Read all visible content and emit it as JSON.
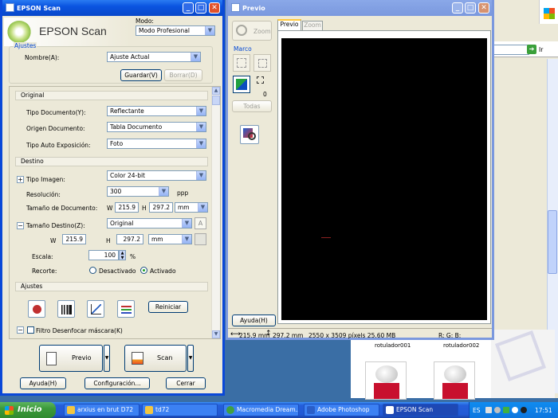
{
  "background_window": {
    "go_label": "Ir",
    "files": [
      {
        "name": "rotulador001"
      },
      {
        "name": "rotulador002"
      }
    ]
  },
  "epson": {
    "title": "EPSON Scan",
    "logo_text": "EPSON Scan",
    "mode_label": "Modo:",
    "mode_value": "Modo Profesional",
    "ajustes_group": "Ajustes",
    "nombre_label": "Nombre(A):",
    "nombre_value": "Ajuste Actual",
    "guardar_label": "Guardar(V)",
    "borrar_label": "Borrar(D)",
    "original_section": "Original",
    "tipo_doc_label": "Tipo Documento(Y):",
    "tipo_doc_value": "Reflectante",
    "origen_label": "Origen Documento:",
    "origen_value": "Tabla Documento",
    "tipo_auto_label": "Tipo Auto Exposición:",
    "tipo_auto_value": "Foto",
    "destino_section": "Destino",
    "tipo_imagen_label": "Tipo Imagen:",
    "tipo_imagen_value": "Color 24-bit",
    "resolucion_label": "Resolución:",
    "resolucion_value": "300",
    "resolucion_unit": "ppp",
    "tamano_doc_label": "Tamaño de Documento:",
    "w_label": "W",
    "h_label": "H",
    "doc_w": "215.9",
    "doc_h": "297.2",
    "unit_value": "mm",
    "tamano_dest_label": "Tamaño Destino(Z):",
    "tamano_dest_value": "Original",
    "dest_w": "215.9",
    "dest_h": "297.2",
    "dest_unit": "mm",
    "escala_label": "Escala:",
    "escala_value": "100",
    "escala_unit": "%",
    "recorte_label": "Recorte:",
    "desactivado_label": "Desactivado",
    "activado_label": "Activado",
    "ajustes_section": "Ajustes",
    "reiniciar_label": "Reiniciar",
    "filtro_label": "Filtro Desenfocar máscara(K)",
    "previo_label": "Previo",
    "scan_label": "Scan",
    "ayuda_label": "Ayuda(H)",
    "config_label": "Configuración...",
    "cerrar_label": "Cerrar"
  },
  "preview": {
    "title": "Previo",
    "zoom_label": "Zoom",
    "marco_label": "Marco",
    "marco_count": "0",
    "todas_label": "Todas",
    "tab_previo": "Previo",
    "tab_zoom": "Zoom",
    "ayuda_label": "Ayuda(H)",
    "status_w": "215.9 mm",
    "status_h": "297.2 mm",
    "status_pixels": "2550 x 3509 píxels 25.60 MB",
    "status_rgb": "R: G: B:"
  },
  "taskbar": {
    "start_label": "Inicio",
    "tasks": [
      {
        "label": "arxius en brut D72"
      },
      {
        "label": "td72"
      },
      {
        "label": "Macromedia Dream..."
      },
      {
        "label": "Adobe Photoshop"
      },
      {
        "label": "EPSON Scan"
      }
    ],
    "lang": "ES",
    "clock": "17:51"
  },
  "colors": {
    "titlebar": "#0a54e0",
    "preview_bg": "#000000",
    "desktop": "#3a6ea5"
  }
}
